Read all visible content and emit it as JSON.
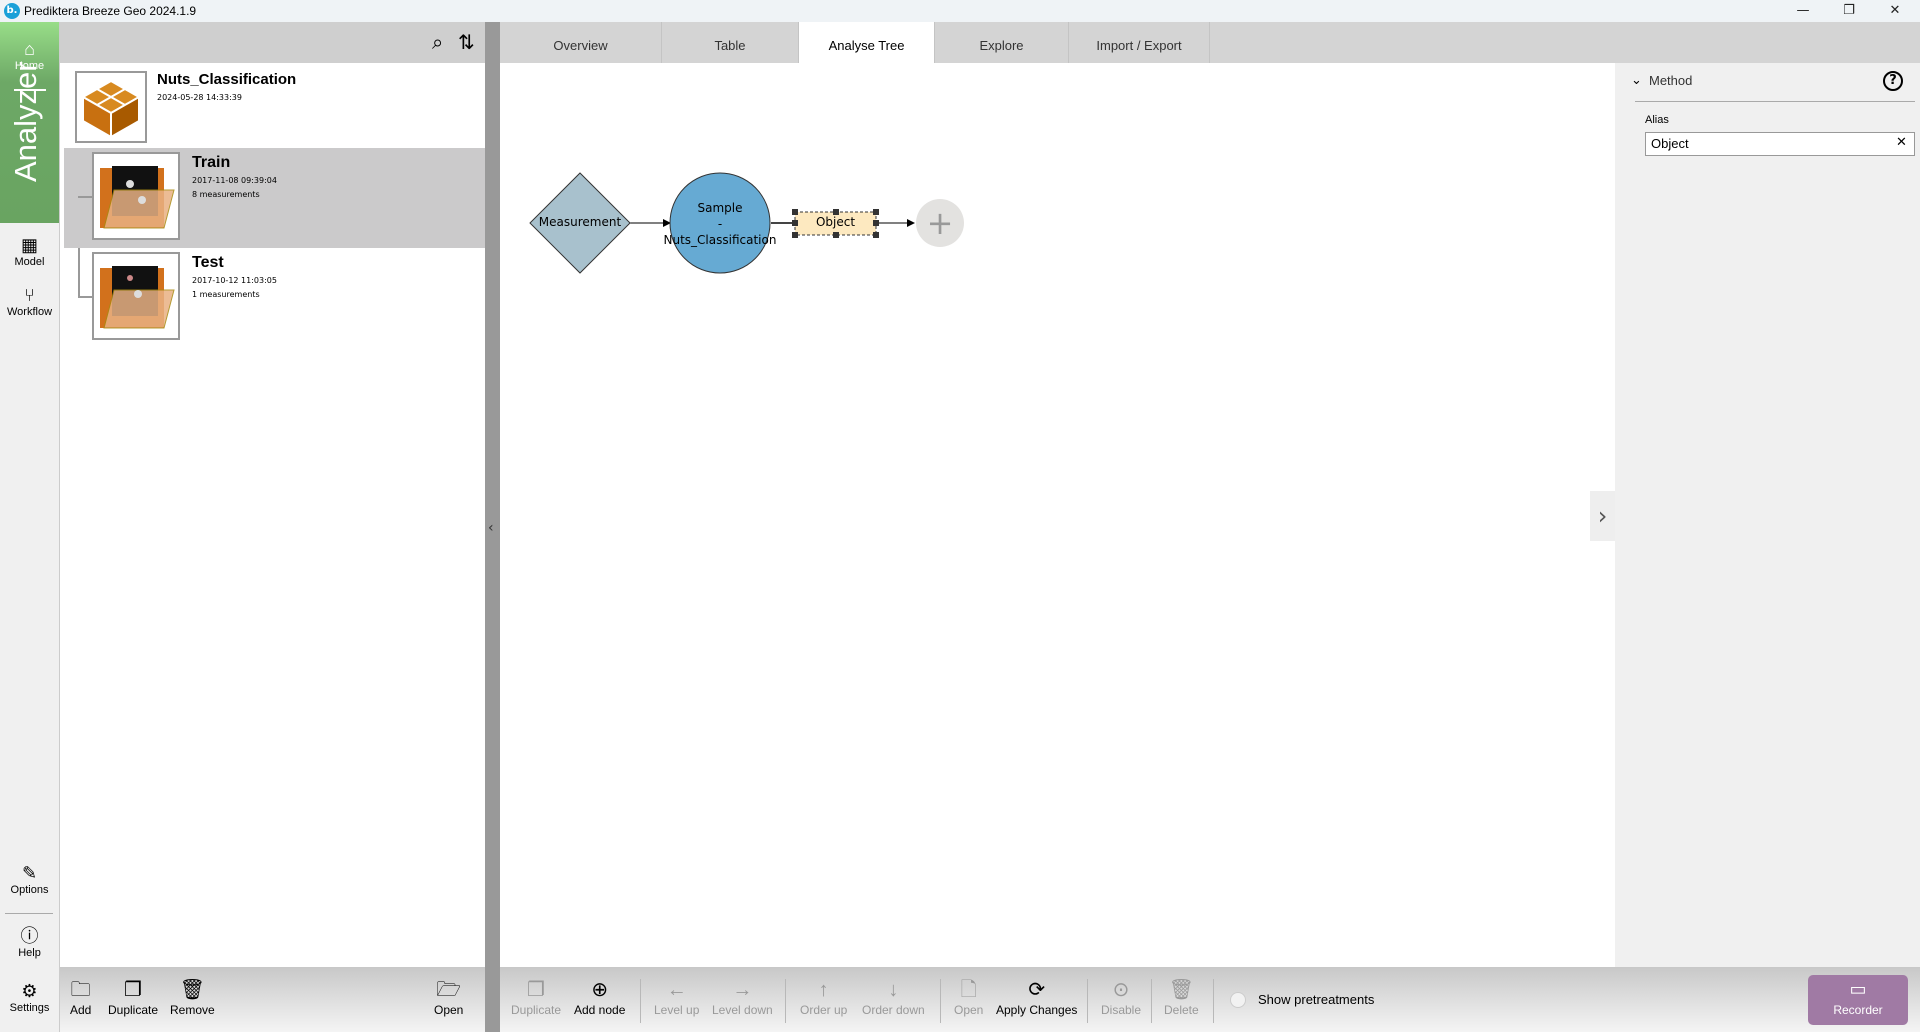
{
  "window": {
    "title": "Prediktera Breeze Geo 2024.1.9",
    "logo": "b.",
    "minimize": "—",
    "maximize": "❐",
    "close": "✕"
  },
  "rail": {
    "home": "Home",
    "analyzer": "Analyzer",
    "model": "Model",
    "workflow": "Workflow",
    "options": "Options",
    "help": "Help",
    "settings": "Settings"
  },
  "project": {
    "name": "Nuts_Classification",
    "date": "2024-05-28 14:33:39"
  },
  "groups": [
    {
      "name": "Train",
      "date": "2017-11-08 09:39:04",
      "count": "8 measurements",
      "selected": true
    },
    {
      "name": "Test",
      "date": "2017-10-12 11:03:05",
      "count": "1 measurements",
      "selected": false
    }
  ],
  "left_toolbar": {
    "add": "Add",
    "duplicate": "Duplicate",
    "remove": "Remove",
    "open": "Open"
  },
  "tabs": [
    {
      "label": "Overview"
    },
    {
      "label": "Table"
    },
    {
      "label": "Analyse Tree",
      "active": true
    },
    {
      "label": "Explore"
    },
    {
      "label": "Import / Export"
    }
  ],
  "tree": {
    "measurement": "Measurement",
    "sample_line1": "Sample",
    "sample_line2": "-",
    "sample_line3": "Nuts_Classification",
    "object": "Object",
    "add": "+"
  },
  "method": {
    "header": "Method",
    "alias_label": "Alias",
    "alias_value": "Object",
    "help": "?",
    "clear": "✕"
  },
  "toolbar": {
    "duplicate": "Duplicate",
    "add_node": "Add node",
    "level_up": "Level up",
    "level_down": "Level down",
    "order_up": "Order up",
    "order_down": "Order down",
    "open": "Open",
    "apply": "Apply Changes",
    "disable": "Disable",
    "delete": "Delete",
    "show_pretreatments": "Show pretreatments",
    "show_pretreatments_checked": false,
    "recorder": "Recorder"
  },
  "colors": {
    "rail_green": "#6da866",
    "measurement": "#a8c1cd",
    "sample": "#66aad3",
    "object": "#fde9c0",
    "recorder": "#a07aa4"
  }
}
